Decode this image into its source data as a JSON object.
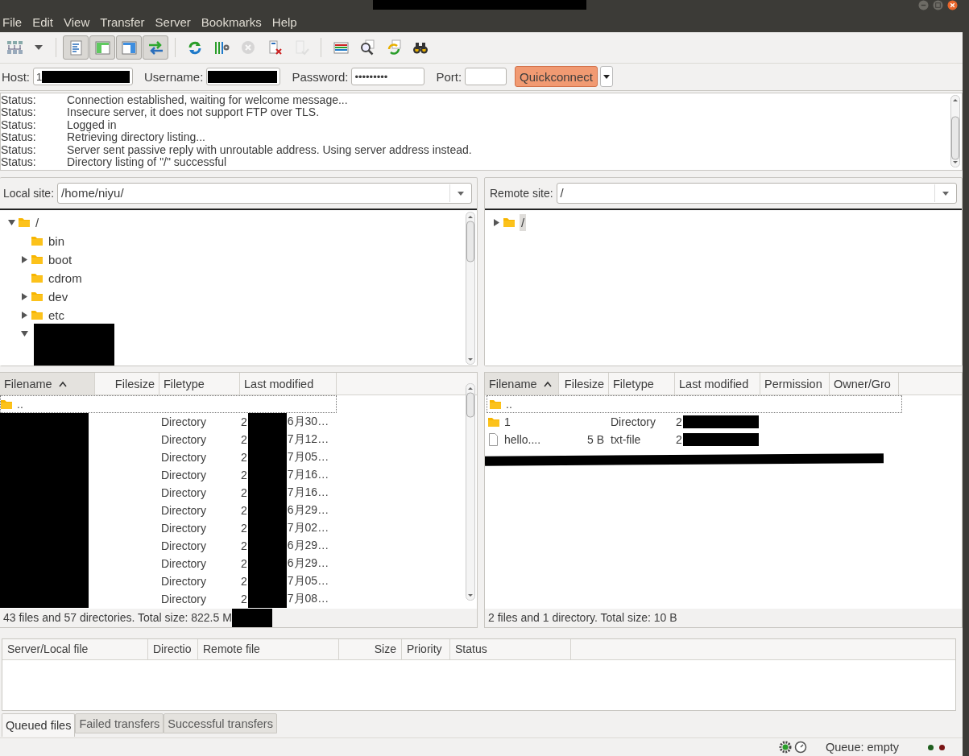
{
  "window": {
    "title_redacted": true,
    "buttons": [
      {
        "kind": "minimize"
      },
      {
        "kind": "maximize"
      },
      {
        "kind": "close"
      }
    ]
  },
  "menu": [
    "File",
    "Edit",
    "View",
    "Transfer",
    "Server",
    "Bookmarks",
    "Help"
  ],
  "toolbar": [
    [
      {
        "kind": "sitemanager",
        "pressed": false,
        "disabled": false
      },
      {
        "kind": "caret",
        "pressed": false,
        "disabled": false
      }
    ],
    [
      {
        "kind": "log",
        "pressed": true,
        "disabled": false
      },
      {
        "kind": "localtree",
        "pressed": true,
        "disabled": false
      },
      {
        "kind": "remotetree",
        "pressed": true,
        "disabled": false
      },
      {
        "kind": "queue",
        "pressed": true,
        "disabled": false
      }
    ],
    [
      {
        "kind": "refresh",
        "pressed": false,
        "disabled": false
      },
      {
        "kind": "filter",
        "pressed": false,
        "disabled": false
      },
      {
        "kind": "cancel",
        "pressed": false,
        "disabled": true
      },
      {
        "kind": "disconnect",
        "pressed": false,
        "disabled": false
      },
      {
        "kind": "reconnect",
        "pressed": false,
        "disabled": true
      }
    ],
    [
      {
        "kind": "compare",
        "pressed": false,
        "disabled": false
      },
      {
        "kind": "search",
        "pressed": false,
        "disabled": false
      },
      {
        "kind": "sync",
        "pressed": false,
        "disabled": false
      },
      {
        "kind": "find",
        "pressed": false,
        "disabled": false
      }
    ]
  ],
  "quickconnect": {
    "fields": [
      {
        "label": "Host:",
        "value": "1",
        "redacted": true,
        "kind": "host"
      },
      {
        "label": "Username:",
        "redacted": true,
        "kind": "user"
      },
      {
        "label": "Password:",
        "value": "•••••••••",
        "kind": "pass"
      },
      {
        "label": "Port:",
        "kind": "port"
      }
    ],
    "button": "Quickconnect"
  },
  "log": [
    {
      "type": "Status:",
      "message": "Connection established, waiting for welcome message..."
    },
    {
      "type": "Status:",
      "message": "Insecure server, it does not support FTP over TLS."
    },
    {
      "type": "Status:",
      "message": "Logged in"
    },
    {
      "type": "Status:",
      "message": "Retrieving directory listing..."
    },
    {
      "type": "Status:",
      "message": "Server sent passive reply with unroutable address. Using server address instead."
    },
    {
      "type": "Status:",
      "message": "Directory listing of \"/\" successful"
    }
  ],
  "panes": [
    {
      "label": "Local site:",
      "path": "/home/niyu/",
      "tree": [
        {
          "name": "/",
          "expandable": true,
          "expanded": true,
          "selected": false,
          "children": [
            {
              "name": "bin",
              "selected": false
            },
            {
              "name": "boot",
              "expandable": true,
              "expanded": false,
              "selected": false
            },
            {
              "name": "cdrom",
              "selected": false
            },
            {
              "name": "dev",
              "expandable": true,
              "expanded": false,
              "selected": false
            },
            {
              "name": "etc",
              "expandable": true,
              "expanded": false,
              "selected": false
            },
            {
              "expandable": true,
              "expanded": true,
              "redacted": true
            }
          ]
        }
      ],
      "columns": [
        {
          "label": "Filename",
          "sorted": true
        },
        {
          "label": "Filesize",
          "sorted": false
        },
        {
          "label": "Filetype",
          "sorted": false
        },
        {
          "label": "Last modified",
          "sorted": false
        }
      ],
      "rows": [
        {
          "kind": "parent",
          "name": ".."
        },
        {
          "kind": "dir",
          "name_redacted": true,
          "type": "Directory",
          "modified": "2",
          "modified_redacted": true,
          "modified_end": "6月30…"
        },
        {
          "kind": "dir",
          "name_redacted": true,
          "type": "Directory",
          "modified": "2",
          "modified_redacted": true,
          "modified_end": "7月12…"
        },
        {
          "kind": "dir",
          "name_redacted": true,
          "type": "Directory",
          "modified": "2",
          "modified_redacted": true,
          "modified_end": "7月05…"
        },
        {
          "kind": "dir",
          "name_redacted": true,
          "type": "Directory",
          "modified": "2",
          "modified_redacted": true,
          "modified_end": "7月16…"
        },
        {
          "kind": "dir",
          "name_redacted": true,
          "type": "Directory",
          "modified": "2",
          "modified_redacted": true,
          "modified_end": "7月16…"
        },
        {
          "kind": "dir",
          "name_redacted": true,
          "type": "Directory",
          "modified": "2",
          "modified_redacted": true,
          "modified_end": "6月29…"
        },
        {
          "kind": "dir",
          "name_redacted": true,
          "type": "Directory",
          "modified": "2",
          "modified_redacted": true,
          "modified_end": "7月02…"
        },
        {
          "kind": "dir",
          "name_redacted": true,
          "type": "Directory",
          "modified": "2",
          "modified_redacted": true,
          "modified_end": "6月29…"
        },
        {
          "kind": "dir",
          "name_redacted": true,
          "type": "Directory",
          "modified": "2",
          "modified_redacted": true,
          "modified_end": "6月29…"
        },
        {
          "kind": "dir",
          "name_redacted": true,
          "type": "Directory",
          "modified": "2",
          "modified_redacted": true,
          "modified_end": "7月05…"
        },
        {
          "kind": "dir",
          "name_redacted": true,
          "type": "Directory",
          "modified": "2",
          "modified_redacted": true,
          "modified_end": "7月08…"
        }
      ],
      "status": "43 files and 57 directories. Total size: 822.5 M",
      "status_redacted": true
    },
    {
      "label": "Remote site:",
      "path": "/",
      "tree": [
        {
          "name": "/",
          "expandable": true,
          "expanded": false,
          "selected": true
        }
      ],
      "columns": [
        {
          "label": "Filename",
          "sorted": true
        },
        {
          "label": "Filesize",
          "sorted": false
        },
        {
          "label": "Filetype",
          "sorted": false
        },
        {
          "label": "Last modified",
          "sorted": false
        },
        {
          "label": "Permission",
          "sorted": false
        },
        {
          "label": "Owner/Gro",
          "sorted": false
        }
      ],
      "rows": [
        {
          "kind": "parent",
          "name": ".."
        },
        {
          "kind": "dir",
          "name": "1",
          "type": "Directory",
          "modified": "2",
          "rest_redacted": true
        },
        {
          "kind": "file",
          "name": "hello....",
          "size": "5 B",
          "type": "txt-file",
          "modified": "2",
          "rest_redacted": true
        },
        {
          "kind": "hidden"
        }
      ],
      "status": "2 files and 1 directory. Total size: 10 B"
    }
  ],
  "queue": {
    "columns": [
      "Server/Local file",
      "Directio",
      "Remote file",
      "Size",
      "Priority",
      "Status"
    ],
    "tabs": [
      {
        "label": "Queued files",
        "selected": true
      },
      {
        "label": "Failed transfers",
        "selected": false
      },
      {
        "label": "Successful transfers",
        "selected": false
      }
    ]
  },
  "status_bar": {
    "queue": "Queue: empty",
    "leds": [
      {
        "color": "#1f5f1f"
      },
      {
        "color": "#7a1414"
      }
    ]
  }
}
